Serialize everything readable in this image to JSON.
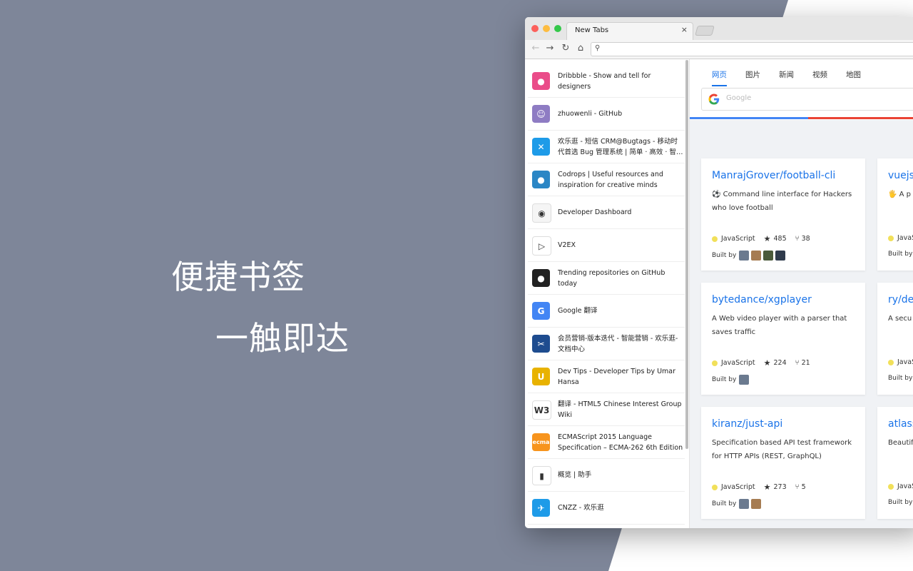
{
  "slogan": {
    "line1": "便捷书签",
    "line2": "一触即达"
  },
  "browser": {
    "tab_title": "New Tabs",
    "tab_close": "×",
    "nav": {
      "back": "←",
      "forward": "→",
      "reload": "↻",
      "home": "⌂"
    },
    "omnibox_icon": "⚲"
  },
  "bookmarks": [
    {
      "label": "Dribbble - Show and tell for designers",
      "icon": "dribbble-icon",
      "color": "#ea4c89",
      "glyph": "●"
    },
    {
      "label": "zhuowenli - GitHub",
      "icon": "github-avatar-icon",
      "color": "#8e7cc3",
      "glyph": "☺"
    },
    {
      "label": "欢乐逛 - 短信 CRM@Bugtags - 移动时代首选 Bug 管理系统 | 简单 · 高效 · 智能 · ...",
      "icon": "bugtags-icon",
      "color": "#1e9be8",
      "glyph": "✕"
    },
    {
      "label": "Codrops | Useful resources and inspiration for creative minds",
      "icon": "codrops-icon",
      "color": "#2b86c5",
      "glyph": "●"
    },
    {
      "label": "Developer Dashboard",
      "icon": "chrome-icon",
      "color": "#f5f5f5",
      "glyph": "◉"
    },
    {
      "label": "V2EX",
      "icon": "v2ex-icon",
      "color": "#ffffff",
      "glyph": "▷"
    },
    {
      "label": "Trending repositories on GitHub today",
      "icon": "github-icon",
      "color": "#222222",
      "glyph": "●"
    },
    {
      "label": "Google 翻译",
      "icon": "google-translate-icon",
      "color": "#4285f4",
      "glyph": "G"
    },
    {
      "label": "会员营销-版本迭代 - 智能营销 - 欢乐逛-文档中心",
      "icon": "scissors-logo-icon",
      "color": "#1e4c8f",
      "glyph": "✂"
    },
    {
      "label": "Dev Tips - Developer Tips by Umar Hansa",
      "icon": "devtips-icon",
      "color": "#e8b200",
      "glyph": "U"
    },
    {
      "label": "翻译 - HTML5 Chinese Interest Group Wiki",
      "icon": "w3c-icon",
      "color": "#ffffff",
      "glyph": "W3"
    },
    {
      "label": "ECMAScript 2015 Language Specification – ECMA-262 6th Edition",
      "icon": "ecma-icon",
      "color": "#f7941d",
      "glyph": "ecma"
    },
    {
      "label": "概览 | 助手",
      "icon": "bar-chart-icon",
      "color": "#ffffff",
      "glyph": "▮"
    },
    {
      "label": "CNZZ - 欢乐逛",
      "icon": "cnzz-icon",
      "color": "#1e9be8",
      "glyph": "✈"
    }
  ],
  "search": {
    "tabs": [
      "网页",
      "图片",
      "新闻",
      "视频",
      "地图"
    ],
    "active_tab": 0,
    "placeholder": "Google",
    "engine_icon": "google-g-icon"
  },
  "repos": [
    {
      "name": "ManrajGrover/football-cli",
      "desc": "⚽  Command line interface for Hackers who love football",
      "lang": "JavaScript",
      "stars": "485",
      "forks": "38",
      "built_by": "Built by",
      "avatars": 4
    },
    {
      "name": "vuejs",
      "desc": "🖐  A p adopta building",
      "lang": "JavaS",
      "stars": "",
      "forks": "",
      "built_by": "Built by",
      "avatars": 0
    },
    {
      "name": "bytedance/xgplayer",
      "desc": "A Web video player with a parser that saves traffic",
      "lang": "JavaScript",
      "stars": "224",
      "forks": "21",
      "built_by": "Built by",
      "avatars": 1
    },
    {
      "name": "ry/de",
      "desc": "A secu",
      "lang": "JavaS",
      "stars": "",
      "forks": "",
      "built_by": "Built by",
      "avatars": 0
    },
    {
      "name": "kiranz/just-api",
      "desc": "Specification based API test framework for HTTP APIs (REST, GraphQL)",
      "lang": "JavaScript",
      "stars": "273",
      "forks": "5",
      "built_by": "Built by",
      "avatars": 2
    },
    {
      "name": "atlass",
      "desc": "Beautif lists wi",
      "lang": "JavaS",
      "stars": "",
      "forks": "",
      "built_by": "Built by",
      "avatars": 0
    }
  ],
  "colors": {
    "background": "#7e8699",
    "accent": "#1a73e8",
    "js_dot": "#f1e05a"
  },
  "icons": {
    "star": "★",
    "fork": "⑂"
  }
}
